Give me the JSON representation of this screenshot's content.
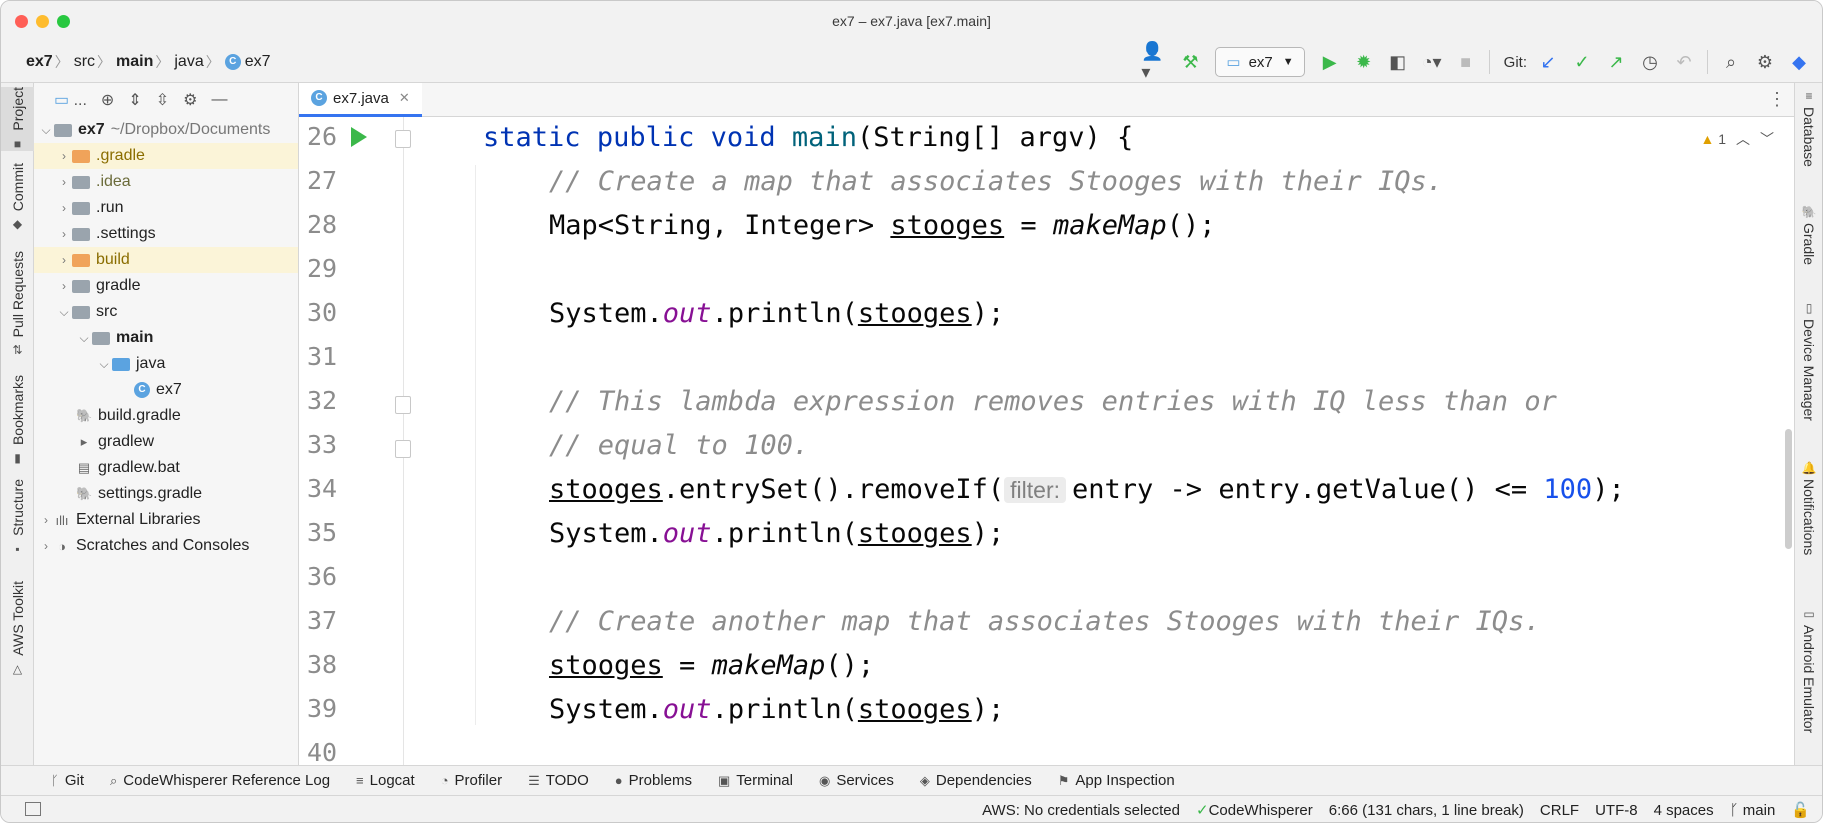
{
  "window": {
    "title": "ex7 – ex7.java [ex7.main]"
  },
  "breadcrumbs": [
    "ex7",
    "src",
    "main",
    "java",
    "ex7"
  ],
  "toolbar": {
    "run_config": "ex7",
    "git_label": "Git:"
  },
  "left_tabs": [
    "Project",
    "Commit",
    "Pull Requests",
    "Bookmarks",
    "Structure",
    "AWS Toolkit"
  ],
  "right_tabs": [
    "Database",
    "Gradle",
    "Device Manager",
    "Notifications",
    "Android Emulator"
  ],
  "project_panel": {
    "toolbar_label": "...",
    "tree": [
      {
        "label": "ex7",
        "suffix": "~/Dropbox/Documents",
        "depth": 0,
        "arrow": "v",
        "type": "module"
      },
      {
        "label": ".gradle",
        "depth": 1,
        "arrow": ">",
        "type": "folder-orange"
      },
      {
        "label": ".idea",
        "depth": 1,
        "arrow": ">",
        "type": "folder"
      },
      {
        "label": ".run",
        "depth": 1,
        "arrow": ">",
        "type": "folder"
      },
      {
        "label": ".settings",
        "depth": 1,
        "arrow": ">",
        "type": "folder"
      },
      {
        "label": "build",
        "depth": 1,
        "arrow": ">",
        "type": "folder-orange"
      },
      {
        "label": "gradle",
        "depth": 1,
        "arrow": ">",
        "type": "folder"
      },
      {
        "label": "src",
        "depth": 1,
        "arrow": "v",
        "type": "folder"
      },
      {
        "label": "main",
        "depth": 2,
        "arrow": "v",
        "type": "folder"
      },
      {
        "label": "java",
        "depth": 3,
        "arrow": "v",
        "type": "folder-blue"
      },
      {
        "label": "ex7",
        "depth": 4,
        "arrow": "",
        "type": "class"
      },
      {
        "label": "build.gradle",
        "depth": 1,
        "arrow": "",
        "type": "gradle"
      },
      {
        "label": "gradlew",
        "depth": 1,
        "arrow": "",
        "type": "exec"
      },
      {
        "label": "gradlew.bat",
        "depth": 1,
        "arrow": "",
        "type": "text"
      },
      {
        "label": "settings.gradle",
        "depth": 1,
        "arrow": "",
        "type": "gradle"
      },
      {
        "label": "External Libraries",
        "depth": 0,
        "arrow": ">",
        "type": "lib"
      },
      {
        "label": "Scratches and Consoles",
        "depth": 0,
        "arrow": ">",
        "type": "scratch"
      }
    ]
  },
  "editor": {
    "tab_label": "ex7.java",
    "warning_count": "1",
    "line_numbers": [
      "26",
      "27",
      "28",
      "29",
      "30",
      "31",
      "32",
      "33",
      "34",
      "35",
      "36",
      "37",
      "38",
      "39",
      "40"
    ],
    "code": {
      "l26_static": "static",
      "l26_public": "public",
      "l26_void": "void",
      "l26_main": "main",
      "l26_rest": "(String[] argv) {",
      "l27": "// Create a map that associates Stooges with their IQs.",
      "l28_a": "Map<String, Integer> ",
      "l28_var": "stooges",
      "l28_b": " = ",
      "l28_call": "makeMap",
      "l28_c": "();",
      "l30_a": "System.",
      "l30_out": "out",
      "l30_b": ".println(",
      "l30_var": "stooges",
      "l30_c": ");",
      "l32": "// This lambda expression removes entries with IQ less than or",
      "l33": "// equal to 100.",
      "l34_var": "stooges",
      "l34_a": ".entrySet().removeIf(",
      "l34_hint": "filter:",
      "l34_b": "entry -> entry.getValue() <= ",
      "l34_num": "100",
      "l34_c": ");",
      "l35_a": "System.",
      "l35_out": "out",
      "l35_b": ".println(",
      "l35_var": "stooges",
      "l35_c": ");",
      "l37": "// Create another map that associates Stooges with their IQs.",
      "l38_var": "stooges",
      "l38_a": " = ",
      "l38_call": "makeMap",
      "l38_b": "();",
      "l39_a": "System.",
      "l39_out": "out",
      "l39_b": ".println(",
      "l39_var": "stooges",
      "l39_c": ");"
    }
  },
  "bottom_tools": [
    "Git",
    "CodeWhisperer Reference Log",
    "Logcat",
    "Profiler",
    "TODO",
    "Problems",
    "Terminal",
    "Services",
    "Dependencies",
    "App Inspection"
  ],
  "status": {
    "aws": "AWS: No credentials selected",
    "codewhisperer": "CodeWhisperer",
    "position": "6:66 (131 chars, 1 line break)",
    "line_ending": "CRLF",
    "encoding": "UTF-8",
    "indent": "4 spaces",
    "branch": "main"
  },
  "colors": {
    "accent": "#3574f0",
    "run_green": "#3bb84a",
    "folder_orange": "#f0a35a",
    "folder_gray": "#9aa4ad",
    "folder_blue": "#5ba3e0"
  }
}
